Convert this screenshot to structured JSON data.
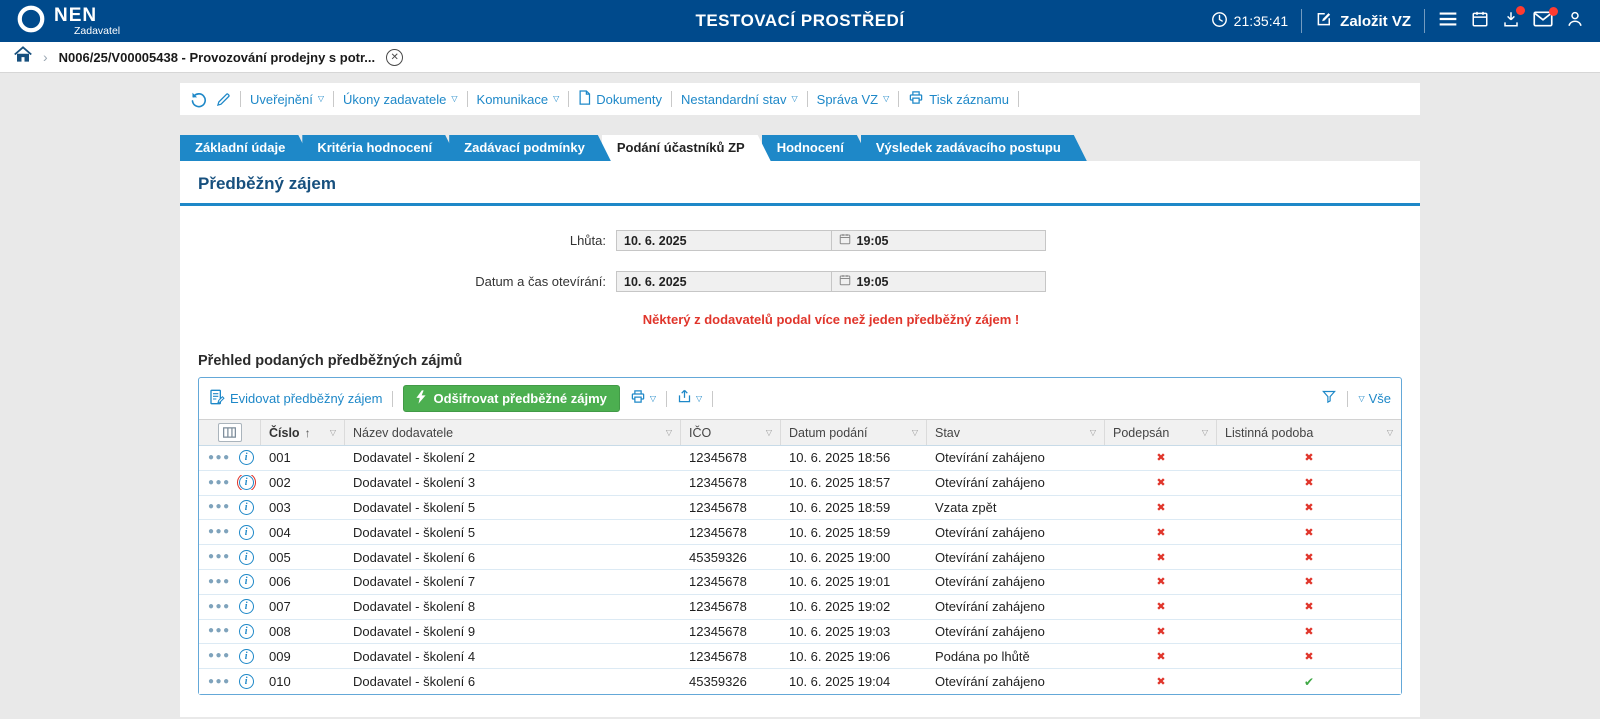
{
  "topbar": {
    "brand": "NEN",
    "brand_sub": "Zadavatel",
    "env_title": "TESTOVACÍ PROSTŘEDÍ",
    "clock": "21:35:41",
    "create_vz_label": "Založit VZ"
  },
  "breadcrumb": {
    "record": "N006/25/V00005438 - Provozování prodejny s potr..."
  },
  "actionbar": {
    "items": [
      {
        "label": "Uveřejnění"
      },
      {
        "label": "Úkony zadavatele"
      },
      {
        "label": "Komunikace"
      },
      {
        "label": "Dokumenty"
      },
      {
        "label": "Nestandardní stav"
      },
      {
        "label": "Správa VZ"
      },
      {
        "label": "Tisk záznamu"
      }
    ]
  },
  "tabs": [
    {
      "label": "Základní údaje",
      "active": false
    },
    {
      "label": "Kritéria hodnocení",
      "active": false
    },
    {
      "label": "Zadávací podmínky",
      "active": false
    },
    {
      "label": "Podání účastníků ZP",
      "active": true
    },
    {
      "label": "Hodnocení",
      "active": false
    },
    {
      "label": "Výsledek zadávacího postupu",
      "active": false
    }
  ],
  "section": {
    "title": "Předběžný zájem",
    "fields": [
      {
        "label": "Lhůta:",
        "date": "10. 6. 2025",
        "time": "19:05"
      },
      {
        "label": "Datum a čas otevírání:",
        "date": "10. 6. 2025",
        "time": "19:05"
      }
    ],
    "warning": "Některý z dodavatelů podal více než jeden předběžný zájem !"
  },
  "grid": {
    "title": "Přehled podaných předběžných zájmů",
    "toolbar": {
      "register_label": "Evidovat předběžný zájem",
      "decrypt_label": "Odšifrovat předběžné zájmy",
      "view_all_label": "Vše"
    },
    "columns": [
      "Číslo",
      "Název dodavatele",
      "IČO",
      "Datum podání",
      "Stav",
      "Podepsán",
      "Listinná podoba"
    ],
    "rows": [
      {
        "cislo": "001",
        "dodavatel": "Dodavatel - školení 2",
        "ico": "12345678",
        "podani": "10. 6. 2025 18:56",
        "stav": "Otevírání zahájeno",
        "podepsan": false,
        "listinna": false,
        "flagged": false
      },
      {
        "cislo": "002",
        "dodavatel": "Dodavatel - školení 3",
        "ico": "12345678",
        "podani": "10. 6. 2025 18:57",
        "stav": "Otevírání zahájeno",
        "podepsan": false,
        "listinna": false,
        "flagged": true
      },
      {
        "cislo": "003",
        "dodavatel": "Dodavatel - školení 5",
        "ico": "12345678",
        "podani": "10. 6. 2025 18:59",
        "stav": "Vzata zpět",
        "podepsan": false,
        "listinna": false,
        "flagged": false
      },
      {
        "cislo": "004",
        "dodavatel": "Dodavatel - školení 5",
        "ico": "12345678",
        "podani": "10. 6. 2025 18:59",
        "stav": "Otevírání zahájeno",
        "podepsan": false,
        "listinna": false,
        "flagged": false
      },
      {
        "cislo": "005",
        "dodavatel": "Dodavatel - školení 6",
        "ico": "45359326",
        "podani": "10. 6. 2025 19:00",
        "stav": "Otevírání zahájeno",
        "podepsan": false,
        "listinna": false,
        "flagged": false
      },
      {
        "cislo": "006",
        "dodavatel": "Dodavatel - školení 7",
        "ico": "12345678",
        "podani": "10. 6. 2025 19:01",
        "stav": "Otevírání zahájeno",
        "podepsan": false,
        "listinna": false,
        "flagged": false
      },
      {
        "cislo": "007",
        "dodavatel": "Dodavatel - školení 8",
        "ico": "12345678",
        "podani": "10. 6. 2025 19:02",
        "stav": "Otevírání zahájeno",
        "podepsan": false,
        "listinna": false,
        "flagged": false
      },
      {
        "cislo": "008",
        "dodavatel": "Dodavatel - školení 9",
        "ico": "12345678",
        "podani": "10. 6. 2025 19:03",
        "stav": "Otevírání zahájeno",
        "podepsan": false,
        "listinna": false,
        "flagged": false
      },
      {
        "cislo": "009",
        "dodavatel": "Dodavatel - školení 4",
        "ico": "12345678",
        "podani": "10. 6. 2025 19:06",
        "stav": "Podána po lhůtě",
        "podepsan": false,
        "listinna": false,
        "flagged": false
      },
      {
        "cislo": "010",
        "dodavatel": "Dodavatel - školení 6",
        "ico": "45359326",
        "podani": "10. 6. 2025 19:04",
        "stav": "Otevírání zahájeno",
        "podepsan": false,
        "listinna": true,
        "flagged": false
      }
    ]
  },
  "colors": {
    "topbar_blue": "#004A8C",
    "accent_blue": "#1E88C8",
    "button_green": "#4CAF50",
    "error_red": "#E0352B",
    "check_green": "#3FA845"
  }
}
